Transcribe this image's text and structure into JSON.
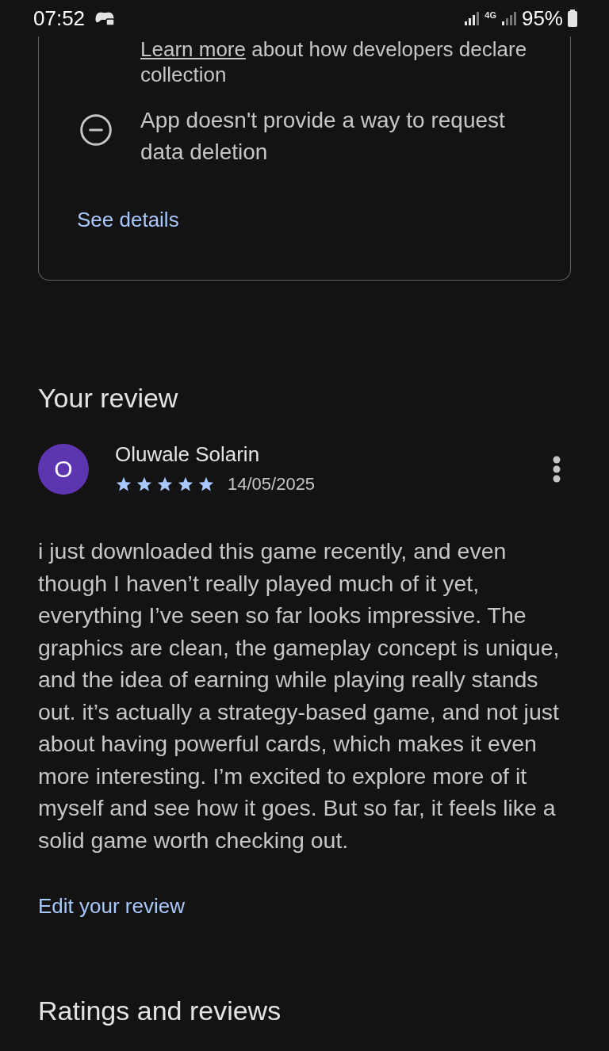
{
  "status_bar": {
    "time": "07:52",
    "network": "4G",
    "battery": "95%"
  },
  "data_safety": {
    "learn_more_link": "Learn more",
    "learn_more_rest": " about how developers declare collection",
    "deletion_note": "App doesn't provide a way to request data deletion",
    "see_details": "See details"
  },
  "your_review": {
    "heading": "Your review",
    "avatar_letter": "O",
    "author": "Oluwale Solarin",
    "stars": 5,
    "date": "14/05/2025",
    "text": "i just downloaded this game recently, and even though I haven’t really played much of it yet, everything I’ve seen so far looks impressive. The graphics are clean, the gameplay concept is unique, and the idea of earning while playing really stands out. it’s actually a strategy-based game, and not just about having powerful cards, which makes it even more interesting. I’m excited to explore more of it myself and see how it goes. But so far, it feels like a solid game worth checking out.",
    "edit_link": "Edit your review"
  },
  "ratings_heading": "Ratings and reviews"
}
